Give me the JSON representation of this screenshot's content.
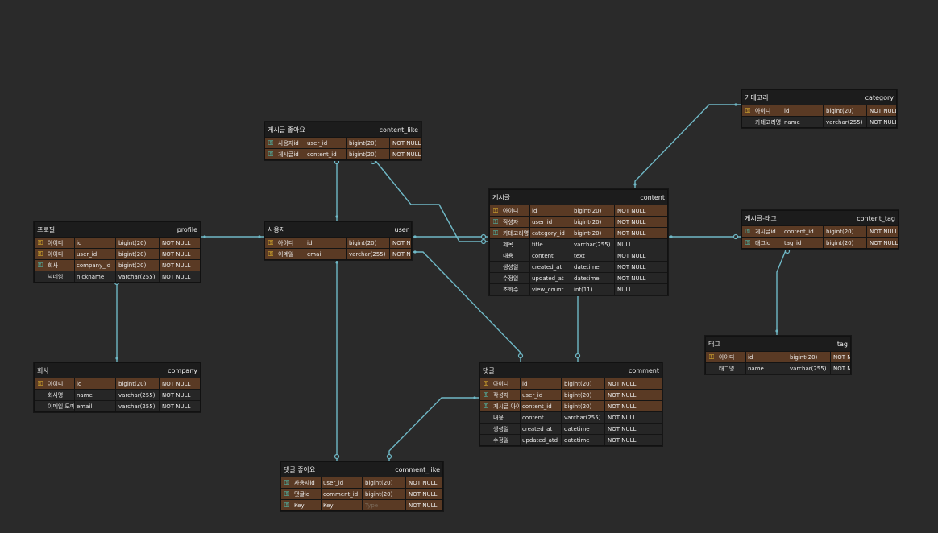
{
  "colors": {
    "background": "#2a2a2a",
    "line": "#6fb8c6",
    "key_row": "#5a3a24",
    "pk_icon": "#f4c430",
    "fk_icon": "#4fd1c5"
  },
  "tables": [
    {
      "id": "profile",
      "logical": "프로필",
      "physical": "profile",
      "rows": [
        {
          "icon": "pk",
          "logical": "아이디",
          "physical": "id",
          "type": "bigint(20)",
          "option": "NOT NULL"
        },
        {
          "icon": "pk",
          "logical": "아이디",
          "physical": "user_id",
          "type": "bigint(20)",
          "option": "NOT NULL"
        },
        {
          "icon": "fk",
          "logical": "회사",
          "physical": "company_id",
          "type": "bigint(20)",
          "option": "NOT NULL"
        },
        {
          "icon": "",
          "logical": "닉네임",
          "physical": "nickname",
          "type": "varchar(255)",
          "option": "NOT NULL"
        }
      ]
    },
    {
      "id": "user",
      "logical": "사용자",
      "physical": "user",
      "rows": [
        {
          "icon": "pk",
          "logical": "아이디",
          "physical": "id",
          "type": "bigint(20)",
          "option": "NOT NULL"
        },
        {
          "icon": "pk",
          "logical": "이메일",
          "physical": "email",
          "type": "varchar(255)",
          "option": "NOT NULL"
        }
      ]
    },
    {
      "id": "content_like",
      "logical": "게시글 좋아요",
      "physical": "content_like",
      "rows": [
        {
          "icon": "fk",
          "logical": "사용자id",
          "physical": "user_id",
          "type": "bigint(20)",
          "option": "NOT NULL"
        },
        {
          "icon": "fk",
          "logical": "게시글id",
          "physical": "content_id",
          "type": "bigint(20)",
          "option": "NOT NULL"
        }
      ]
    },
    {
      "id": "category",
      "logical": "카테고리",
      "physical": "category",
      "rows": [
        {
          "icon": "pk",
          "logical": "아이디",
          "physical": "id",
          "type": "bigint(20)",
          "option": "NOT NULL"
        },
        {
          "icon": "",
          "logical": "카테고리명",
          "physical": "name",
          "type": "varchar(255)",
          "option": "NOT NULL"
        }
      ]
    },
    {
      "id": "content",
      "logical": "게시글",
      "physical": "content",
      "rows": [
        {
          "icon": "pk",
          "logical": "아이디",
          "physical": "id",
          "type": "bigint(20)",
          "option": "NOT NULL"
        },
        {
          "icon": "fk",
          "logical": "작성자",
          "physical": "user_id",
          "type": "bigint(20)",
          "option": "NOT NULL"
        },
        {
          "icon": "fk",
          "logical": "카테고리명",
          "physical": "category_id",
          "type": "bigint(20)",
          "option": "NOT NULL"
        },
        {
          "icon": "",
          "logical": "제목",
          "physical": "title",
          "type": "varchar(255)",
          "option": "NULL"
        },
        {
          "icon": "",
          "logical": "내용",
          "physical": "content",
          "type": "text",
          "option": "NOT NULL"
        },
        {
          "icon": "",
          "logical": "생성일",
          "physical": "created_at",
          "type": "datetime",
          "option": "NOT NULL"
        },
        {
          "icon": "",
          "logical": "수정일",
          "physical": "updated_at",
          "type": "datetime",
          "option": "NOT NULL"
        },
        {
          "icon": "",
          "logical": "조회수",
          "physical": "view_count",
          "type": "int(11)",
          "option": "NULL"
        }
      ]
    },
    {
      "id": "content_tag",
      "logical": "게시글-태그",
      "physical": "content_tag",
      "rows": [
        {
          "icon": "fk",
          "logical": "게시글id",
          "physical": "content_id",
          "type": "bigint(20)",
          "option": "NOT NULL"
        },
        {
          "icon": "fk",
          "logical": "태그id",
          "physical": "tag_id",
          "type": "bigint(20)",
          "option": "NOT NULL"
        }
      ]
    },
    {
      "id": "tag",
      "logical": "태그",
      "physical": "tag",
      "rows": [
        {
          "icon": "pk",
          "logical": "아이디",
          "physical": "id",
          "type": "bigint(20)",
          "option": "NOT NULL"
        },
        {
          "icon": "",
          "logical": "태그명",
          "physical": "name",
          "type": "varchar(255)",
          "option": "NOT NULL"
        }
      ]
    },
    {
      "id": "company",
      "logical": "회사",
      "physical": "company",
      "rows": [
        {
          "icon": "pk",
          "logical": "아이디",
          "physical": "id",
          "type": "bigint(20)",
          "option": "NOT NULL"
        },
        {
          "icon": "",
          "logical": "회사명",
          "physical": "name",
          "type": "varchar(255)",
          "option": "NOT NULL"
        },
        {
          "icon": "",
          "logical": "이메일 도메인",
          "physical": "email",
          "type": "varchar(255)",
          "option": "NOT NULL"
        }
      ]
    },
    {
      "id": "comment",
      "logical": "댓글",
      "physical": "comment",
      "rows": [
        {
          "icon": "pk",
          "logical": "아이디",
          "physical": "id",
          "type": "bigint(20)",
          "option": "NOT NULL"
        },
        {
          "icon": "fk",
          "logical": "작성자",
          "physical": "user_id",
          "type": "bigint(20)",
          "option": "NOT NULL"
        },
        {
          "icon": "fk",
          "logical": "게시글 아이디",
          "physical": "content_id",
          "type": "bigint(20)",
          "option": "NOT NULL"
        },
        {
          "icon": "",
          "logical": "내용",
          "physical": "content",
          "type": "varchar(255)",
          "option": "NOT NULL"
        },
        {
          "icon": "",
          "logical": "생성일",
          "physical": "created_at",
          "type": "datetime",
          "option": "NOT NULL"
        },
        {
          "icon": "",
          "logical": "수정일",
          "physical": "updated_atd",
          "type": "datetime",
          "option": "NOT NULL"
        }
      ]
    },
    {
      "id": "comment_like",
      "logical": "댓글 좋아요",
      "physical": "comment_like",
      "rows": [
        {
          "icon": "fk",
          "logical": "사용자id",
          "physical": "user_id",
          "type": "bigint(20)",
          "option": "NOT NULL"
        },
        {
          "icon": "fk",
          "logical": "댓글id",
          "physical": "comment_id",
          "type": "bigint(20)",
          "option": "NOT NULL"
        },
        {
          "icon": "fk",
          "logical": "Key",
          "physical": "Key",
          "type": "Type",
          "option": "NOT NULL",
          "type_placeholder": true
        }
      ]
    }
  ]
}
